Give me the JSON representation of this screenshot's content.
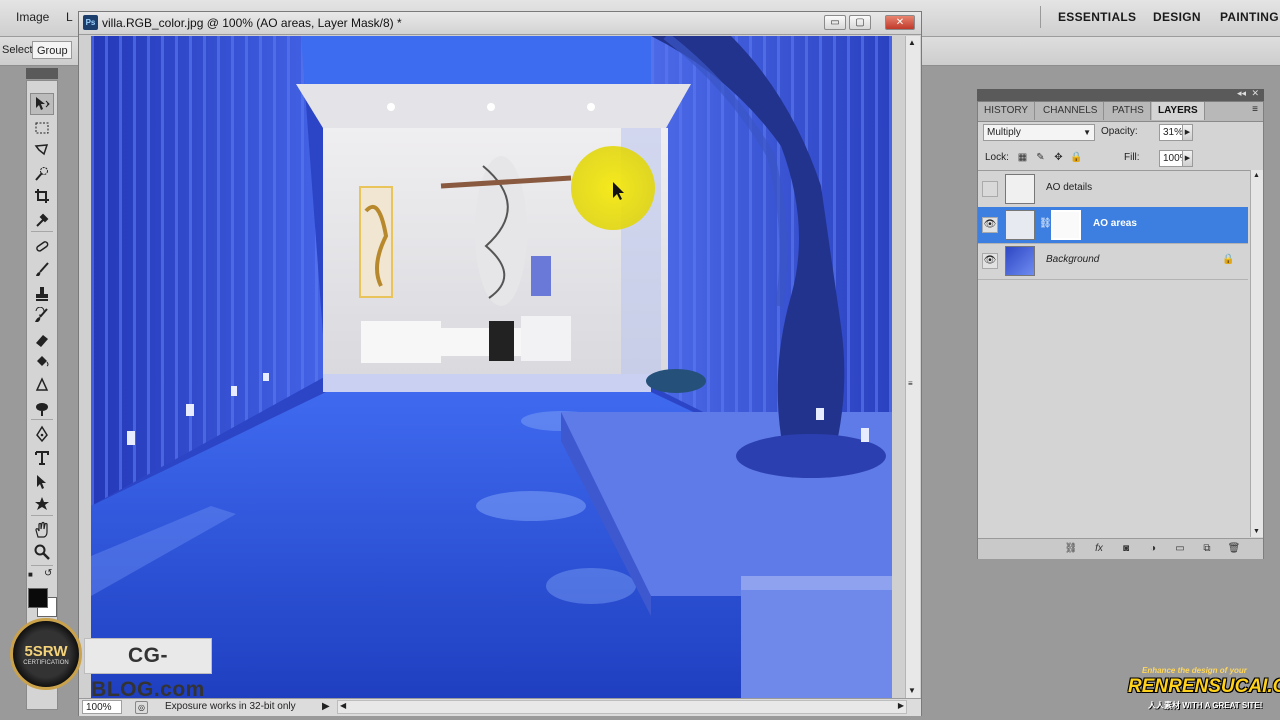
{
  "menubar": {
    "items": [
      "Image",
      "L"
    ],
    "workspaces": [
      "ESSENTIALS",
      "DESIGN",
      "PAINTING"
    ]
  },
  "options_bar": {
    "select_label": "Select:",
    "select_value": "Group"
  },
  "tools": {
    "active": "move-tool",
    "items": [
      "move-tool",
      "marquee-tool",
      "lasso-tool",
      "quick-selection-tool",
      "crop-tool",
      "eyedropper-tool",
      "healing-brush-tool",
      "brush-tool",
      "clone-stamp-tool",
      "history-brush-tool",
      "eraser-tool",
      "paint-bucket-tool",
      "blur-tool",
      "dodge-tool",
      "pen-tool",
      "type-tool",
      "path-selection-tool",
      "custom-shape-tool",
      "hand-tool",
      "zoom-tool"
    ],
    "foreground_color": "#0a0a0a",
    "background_color": "#ffffff"
  },
  "document": {
    "title": "villa.RGB_color.jpg @ 100% (AO areas, Layer Mask/8) *",
    "app_icon": "Ps",
    "zoom": "100%",
    "status_text": "Exposure works in 32-bit only",
    "window_buttons": {
      "minimize": "▭",
      "maximize": "▢",
      "close": "✕"
    }
  },
  "layers_panel": {
    "tabs": [
      "HISTORY",
      "CHANNELS",
      "PATHS",
      "LAYERS"
    ],
    "active_tab": "LAYERS",
    "blend_mode": "Multiply",
    "opacity_label": "Opacity:",
    "opacity": "31%",
    "lock_label": "Lock:",
    "fill_label": "Fill:",
    "fill": "100%",
    "layers": [
      {
        "name": "AO details",
        "visible": false,
        "selected": false,
        "has_mask": false,
        "locked": false
      },
      {
        "name": "AO areas",
        "visible": true,
        "selected": true,
        "has_mask": true,
        "locked": false
      },
      {
        "name": "Background",
        "visible": true,
        "selected": false,
        "has_mask": false,
        "locked": true
      }
    ],
    "bottom_icons": [
      "link-icon",
      "fx-icon",
      "mask-icon",
      "adjustment-icon",
      "group-icon",
      "new-layer-icon",
      "trash-icon"
    ]
  },
  "watermarks": {
    "badge_top": "5SRW",
    "badge_sub": "CERTIFICATION",
    "blog": "CG-BLOG.com",
    "right_line1": "Enhance the design of your",
    "right_line2": "RENRENSUCAI.COM",
    "right_line3": "人人素材 WITH A GREAT SITE!"
  },
  "colors": {
    "selection": "#3c7fe0",
    "canvas_blue": "#2f4fd0",
    "cursor_highlight": "#f2e600"
  }
}
